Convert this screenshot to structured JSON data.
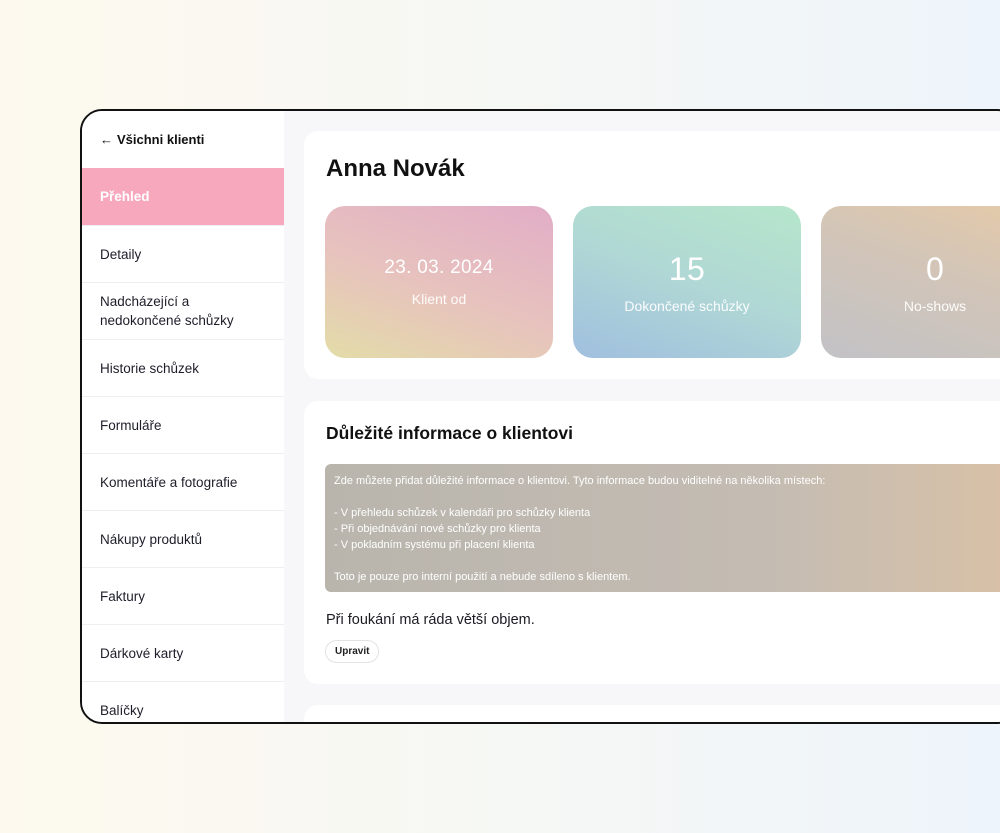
{
  "sidebar": {
    "back_label": "Všichni klienti",
    "items": [
      {
        "label": "Přehled",
        "active": true
      },
      {
        "label": "Detaily"
      },
      {
        "label": "Nadcházející a nedokončené schůzky"
      },
      {
        "label": "Historie schůzek"
      },
      {
        "label": "Formuláře"
      },
      {
        "label": "Komentáře a fotografie"
      },
      {
        "label": "Nákupy produktů"
      },
      {
        "label": "Faktury"
      },
      {
        "label": "Dárkové karty"
      },
      {
        "label": "Balíčky"
      }
    ]
  },
  "client": {
    "name": "Anna Novák",
    "stats": [
      {
        "value": "23. 03. 2024",
        "label": "Klient od"
      },
      {
        "value": "15",
        "label": "Dokončené schůzky"
      },
      {
        "value": "0",
        "label": "No-shows"
      }
    ]
  },
  "info": {
    "title": "Důležité informace o klientovi",
    "hint_lines": [
      "Zde můžete přidat důležité informace o klientovi. Tyto informace budou viditelné na několika místech:",
      "",
      "- V přehledu schůzek v kalendáři pro schůzky klienta",
      "- Při objednávání nové schůzky pro klienta",
      "- V pokladním systému při placení klienta",
      "",
      "Toto je pouze pro interní použití a nebude sdíleno s klientem."
    ],
    "note": "Při foukání má ráda větší objem.",
    "edit_label": "Upravit"
  }
}
